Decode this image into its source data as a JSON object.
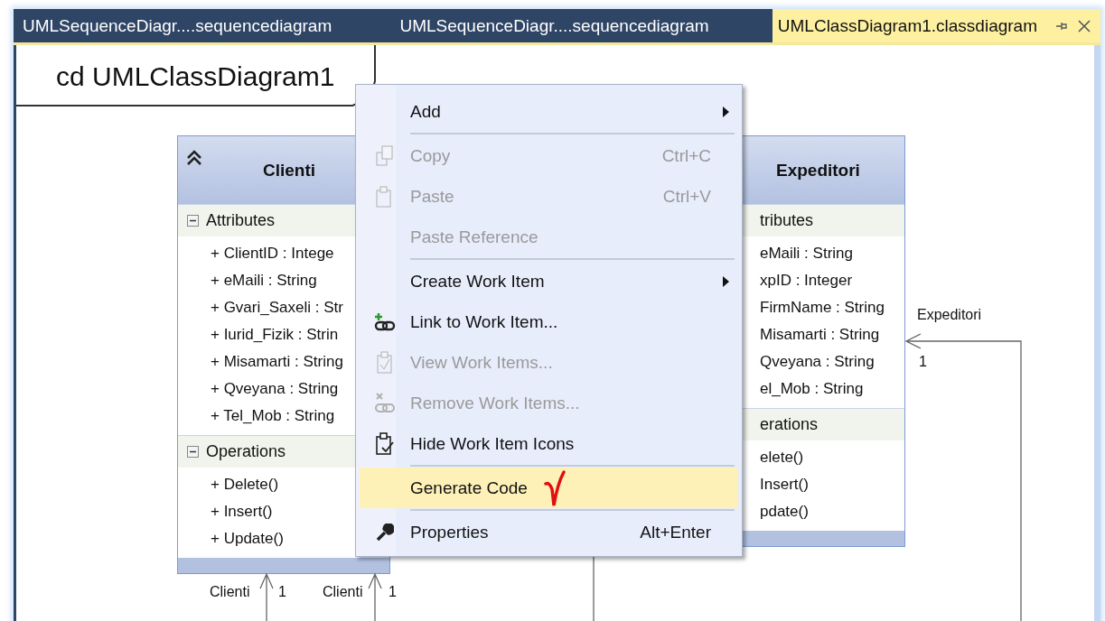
{
  "tabs": [
    {
      "label": "UMLSequenceDiagr....sequencediagram",
      "selected": false
    },
    {
      "label": "UMLSequenceDiagr....sequencediagram",
      "selected": false
    },
    {
      "label": "UMLClassDiagram1.classdiagram",
      "selected": true
    }
  ],
  "diagram": {
    "title": "cd UMLClassDiagram1",
    "classes": [
      {
        "name": "Clienti",
        "expanded": true,
        "compartments": [
          {
            "title": "Attributes",
            "expanded": true,
            "members": [
              "+ ClientID : Intege",
              "+ eMaili : String",
              "+ Gvari_Saxeli : Str",
              "+ Iurid_Fizik : Strin",
              "+ Misamarti : String",
              "+ Qveyana : String",
              "+ Tel_Mob : String"
            ]
          },
          {
            "title": "Operations",
            "expanded": true,
            "members": [
              "+ Delete()",
              "+ Insert()",
              "+ Update()"
            ]
          }
        ]
      },
      {
        "name": "Expeditori",
        "compartments": [
          {
            "title": "tributes",
            "members": [
              "eMaili : String",
              "xpID : Integer",
              "FirmName : String",
              "Misamarti : String",
              "Qveyana : String",
              "el_Mob : String"
            ]
          },
          {
            "title": "erations",
            "members": [
              "elete()",
              "Insert()",
              "pdate()"
            ]
          }
        ]
      }
    ],
    "associations": [
      {
        "role": "Clienti",
        "multiplicity": "1"
      },
      {
        "role": "Clienti",
        "multiplicity": "1"
      },
      {
        "role": "Expeditori",
        "multiplicity": "1"
      }
    ]
  },
  "context_menu": {
    "items": [
      {
        "kind": "item",
        "label": "Add",
        "disabled": false,
        "submenu": true,
        "selected": false,
        "annotated": false
      },
      {
        "kind": "separator"
      },
      {
        "kind": "item",
        "label": "Copy",
        "shortcut": "Ctrl+C",
        "disabled": true,
        "submenu": false,
        "selected": false,
        "annotated": false
      },
      {
        "kind": "item",
        "label": "Paste",
        "shortcut": "Ctrl+V",
        "disabled": true,
        "submenu": false,
        "selected": false,
        "annotated": false
      },
      {
        "kind": "item",
        "label": "Paste Reference",
        "disabled": true,
        "submenu": false,
        "selected": false,
        "annotated": false
      },
      {
        "kind": "separator"
      },
      {
        "kind": "item",
        "label": "Create Work Item",
        "disabled": false,
        "submenu": true,
        "selected": false,
        "annotated": false
      },
      {
        "kind": "item",
        "label": "Link to Work Item...",
        "disabled": false,
        "submenu": false,
        "selected": false,
        "annotated": false
      },
      {
        "kind": "item",
        "label": "View Work Items...",
        "disabled": true,
        "submenu": false,
        "selected": false,
        "annotated": false
      },
      {
        "kind": "item",
        "label": "Remove Work Items...",
        "disabled": true,
        "submenu": false,
        "selected": false,
        "annotated": false
      },
      {
        "kind": "item",
        "label": "Hide Work Item Icons",
        "disabled": false,
        "submenu": false,
        "selected": false,
        "annotated": false
      },
      {
        "kind": "separator"
      },
      {
        "kind": "item",
        "label": "Generate Code",
        "disabled": false,
        "submenu": false,
        "selected": true,
        "annotated": true
      },
      {
        "kind": "separator"
      },
      {
        "kind": "item",
        "label": "Properties",
        "shortcut": "Alt+Enter",
        "disabled": false,
        "submenu": false,
        "selected": false,
        "annotated": false
      }
    ]
  }
}
